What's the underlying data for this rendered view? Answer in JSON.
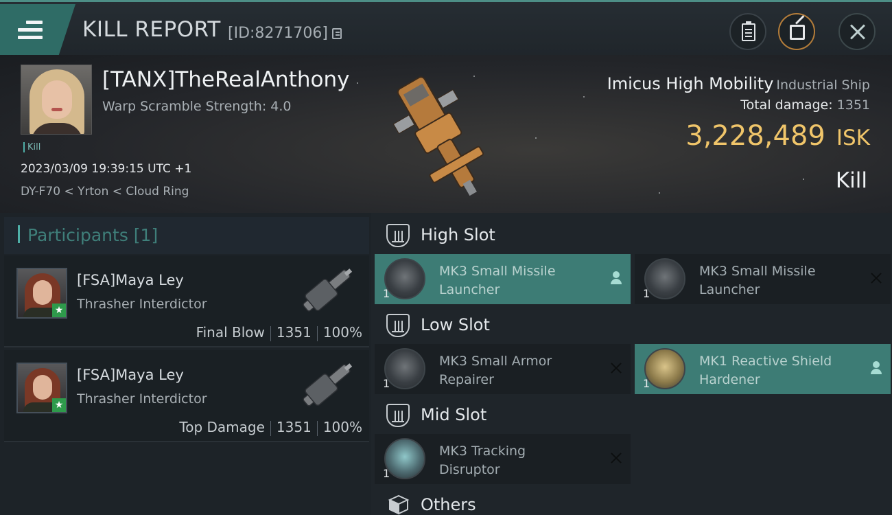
{
  "header": {
    "title": "KILL REPORT",
    "report_id": "[ID:8271706]"
  },
  "victim": {
    "name": "[TANX]TheRealAnthony",
    "warp_scramble": "Warp Scramble Strength: 4.0",
    "tag": "Kill",
    "datetime": "2023/03/09 19:39:15 UTC +1",
    "location": "DY-F70 < Yrton < Cloud Ring",
    "ship_name": "Imicus High Mobility",
    "ship_class": "Industrial Ship",
    "total_damage_label": "Total damage:",
    "total_damage": "1351",
    "isk_value": "3,228,489",
    "isk_unit": "ISK",
    "result": "Kill"
  },
  "participants": {
    "header": "Participants [1]",
    "rows": [
      {
        "name": "[FSA]Maya Ley",
        "ship": "Thrasher Interdictor",
        "role": "Final Blow",
        "damage": "1351",
        "percent": "100%"
      },
      {
        "name": "[FSA]Maya Ley",
        "ship": "Thrasher Interdictor",
        "role": "Top Damage",
        "damage": "1351",
        "percent": "100%"
      }
    ]
  },
  "fitting": {
    "high_slot": {
      "title": "High Slot",
      "modules": [
        {
          "name_line1": "MK3 Small Missile",
          "name_line2": "Launcher",
          "qty": "1",
          "status": "dropped"
        },
        {
          "name_line1": "MK3 Small Missile",
          "name_line2": "Launcher",
          "qty": "1",
          "status": "destroyed"
        }
      ]
    },
    "low_slot": {
      "title": "Low Slot",
      "modules": [
        {
          "name_line1": "MK3 Small Armor",
          "name_line2": "Repairer",
          "qty": "1",
          "status": "destroyed"
        },
        {
          "name_line1": "MK1 Reactive Shield",
          "name_line2": "Hardener",
          "qty": "1",
          "status": "dropped"
        }
      ]
    },
    "mid_slot": {
      "title": "Mid Slot",
      "modules": [
        {
          "name_line1": "MK3 Tracking",
          "name_line2": "Disruptor",
          "qty": "1",
          "status": "destroyed"
        }
      ]
    },
    "others": {
      "title": "Others"
    }
  },
  "colors": {
    "accent": "#3d7c75",
    "isk": "#f0c56a",
    "badge_green": "#2e9a4b"
  },
  "icons": [
    "menu-icon",
    "copy-icon",
    "clipboard-icon",
    "share-icon",
    "close-icon",
    "slot-icon",
    "box-icon",
    "person-icon",
    "x-icon",
    "star-icon"
  ]
}
